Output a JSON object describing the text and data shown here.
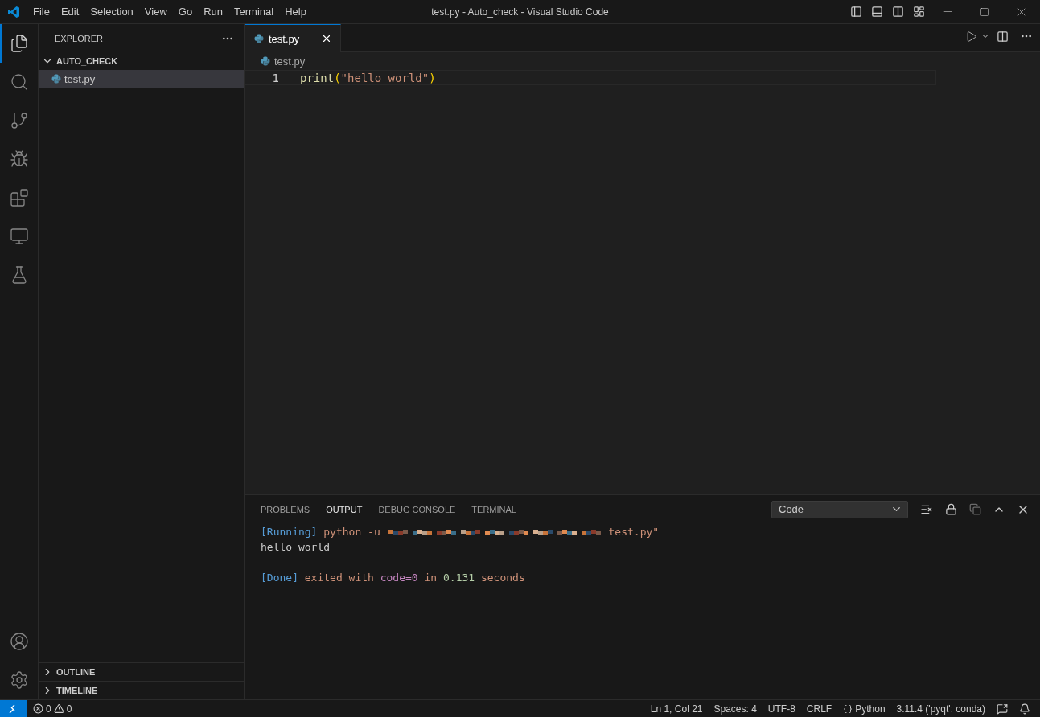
{
  "title_bar": {
    "menu": [
      "File",
      "Edit",
      "Selection",
      "View",
      "Go",
      "Run",
      "Terminal",
      "Help"
    ],
    "title": "test.py - Auto_check - Visual Studio Code"
  },
  "activity_bar": {
    "items": [
      {
        "kind": "explorer",
        "selected": true
      },
      {
        "kind": "search",
        "selected": false
      },
      {
        "kind": "source-control",
        "selected": false
      },
      {
        "kind": "run-debug",
        "selected": false
      },
      {
        "kind": "extensions",
        "selected": false
      },
      {
        "kind": "remote",
        "selected": false
      },
      {
        "kind": "testing",
        "selected": false
      }
    ],
    "bottom": [
      {
        "kind": "account"
      },
      {
        "kind": "settings"
      }
    ]
  },
  "sidebar": {
    "title": "EXPLORER",
    "folder": {
      "label": "AUTO_CHECK",
      "expanded": true,
      "children": [
        {
          "label": "test.py",
          "selected": true
        }
      ]
    },
    "sections": [
      {
        "label": "OUTLINE",
        "expanded": false
      },
      {
        "label": "TIMELINE",
        "expanded": false
      }
    ]
  },
  "editor": {
    "tabs": [
      {
        "label": "test.py",
        "selected": true
      }
    ],
    "breadcrumb": "test.py",
    "lines": [
      {
        "number": "1",
        "tokens": [
          {
            "kind": "function",
            "text": "print"
          },
          {
            "kind": "bracket",
            "text": "("
          },
          {
            "kind": "string",
            "text": "\"hello world\""
          },
          {
            "kind": "bracket",
            "text": ")"
          }
        ]
      }
    ]
  },
  "panel": {
    "tabs": [
      {
        "label": "PROBLEMS",
        "selected": false
      },
      {
        "label": "OUTPUT",
        "selected": true
      },
      {
        "label": "DEBUG CONSOLE",
        "selected": false
      },
      {
        "label": "TERMINAL",
        "selected": false
      }
    ],
    "channel": "Code",
    "output": [
      {
        "gap_before": false,
        "segments": [
          {
            "kind": "tag",
            "text": "[Running]"
          },
          {
            "kind": "plain",
            "text": " python -u "
          },
          {
            "kind": "redacted"
          },
          {
            "kind": "plain",
            "text": "test.py\""
          }
        ]
      },
      {
        "gap_before": false,
        "segments": [
          {
            "kind": "text",
            "text": "hello world"
          }
        ]
      },
      {
        "gap_before": true,
        "segments": [
          {
            "kind": "tag",
            "text": "[Done]"
          },
          {
            "kind": "plain",
            "text": " exited with "
          },
          {
            "kind": "keyword",
            "text": "code=0"
          },
          {
            "kind": "plain",
            "text": " in "
          },
          {
            "kind": "number",
            "text": "0.131"
          },
          {
            "kind": "plain",
            "text": " seconds"
          }
        ]
      }
    ]
  },
  "status_bar": {
    "errors": "0",
    "warnings": "0",
    "items": [
      {
        "kind": "text",
        "label": "Ln 1, Col 21"
      },
      {
        "kind": "text",
        "label": "Spaces: 4"
      },
      {
        "kind": "text",
        "label": "UTF-8"
      },
      {
        "kind": "text",
        "label": "CRLF"
      },
      {
        "kind": "language",
        "label": "Python"
      },
      {
        "kind": "text",
        "label": "3.11.4 ('pyqt': conda)"
      }
    ]
  }
}
